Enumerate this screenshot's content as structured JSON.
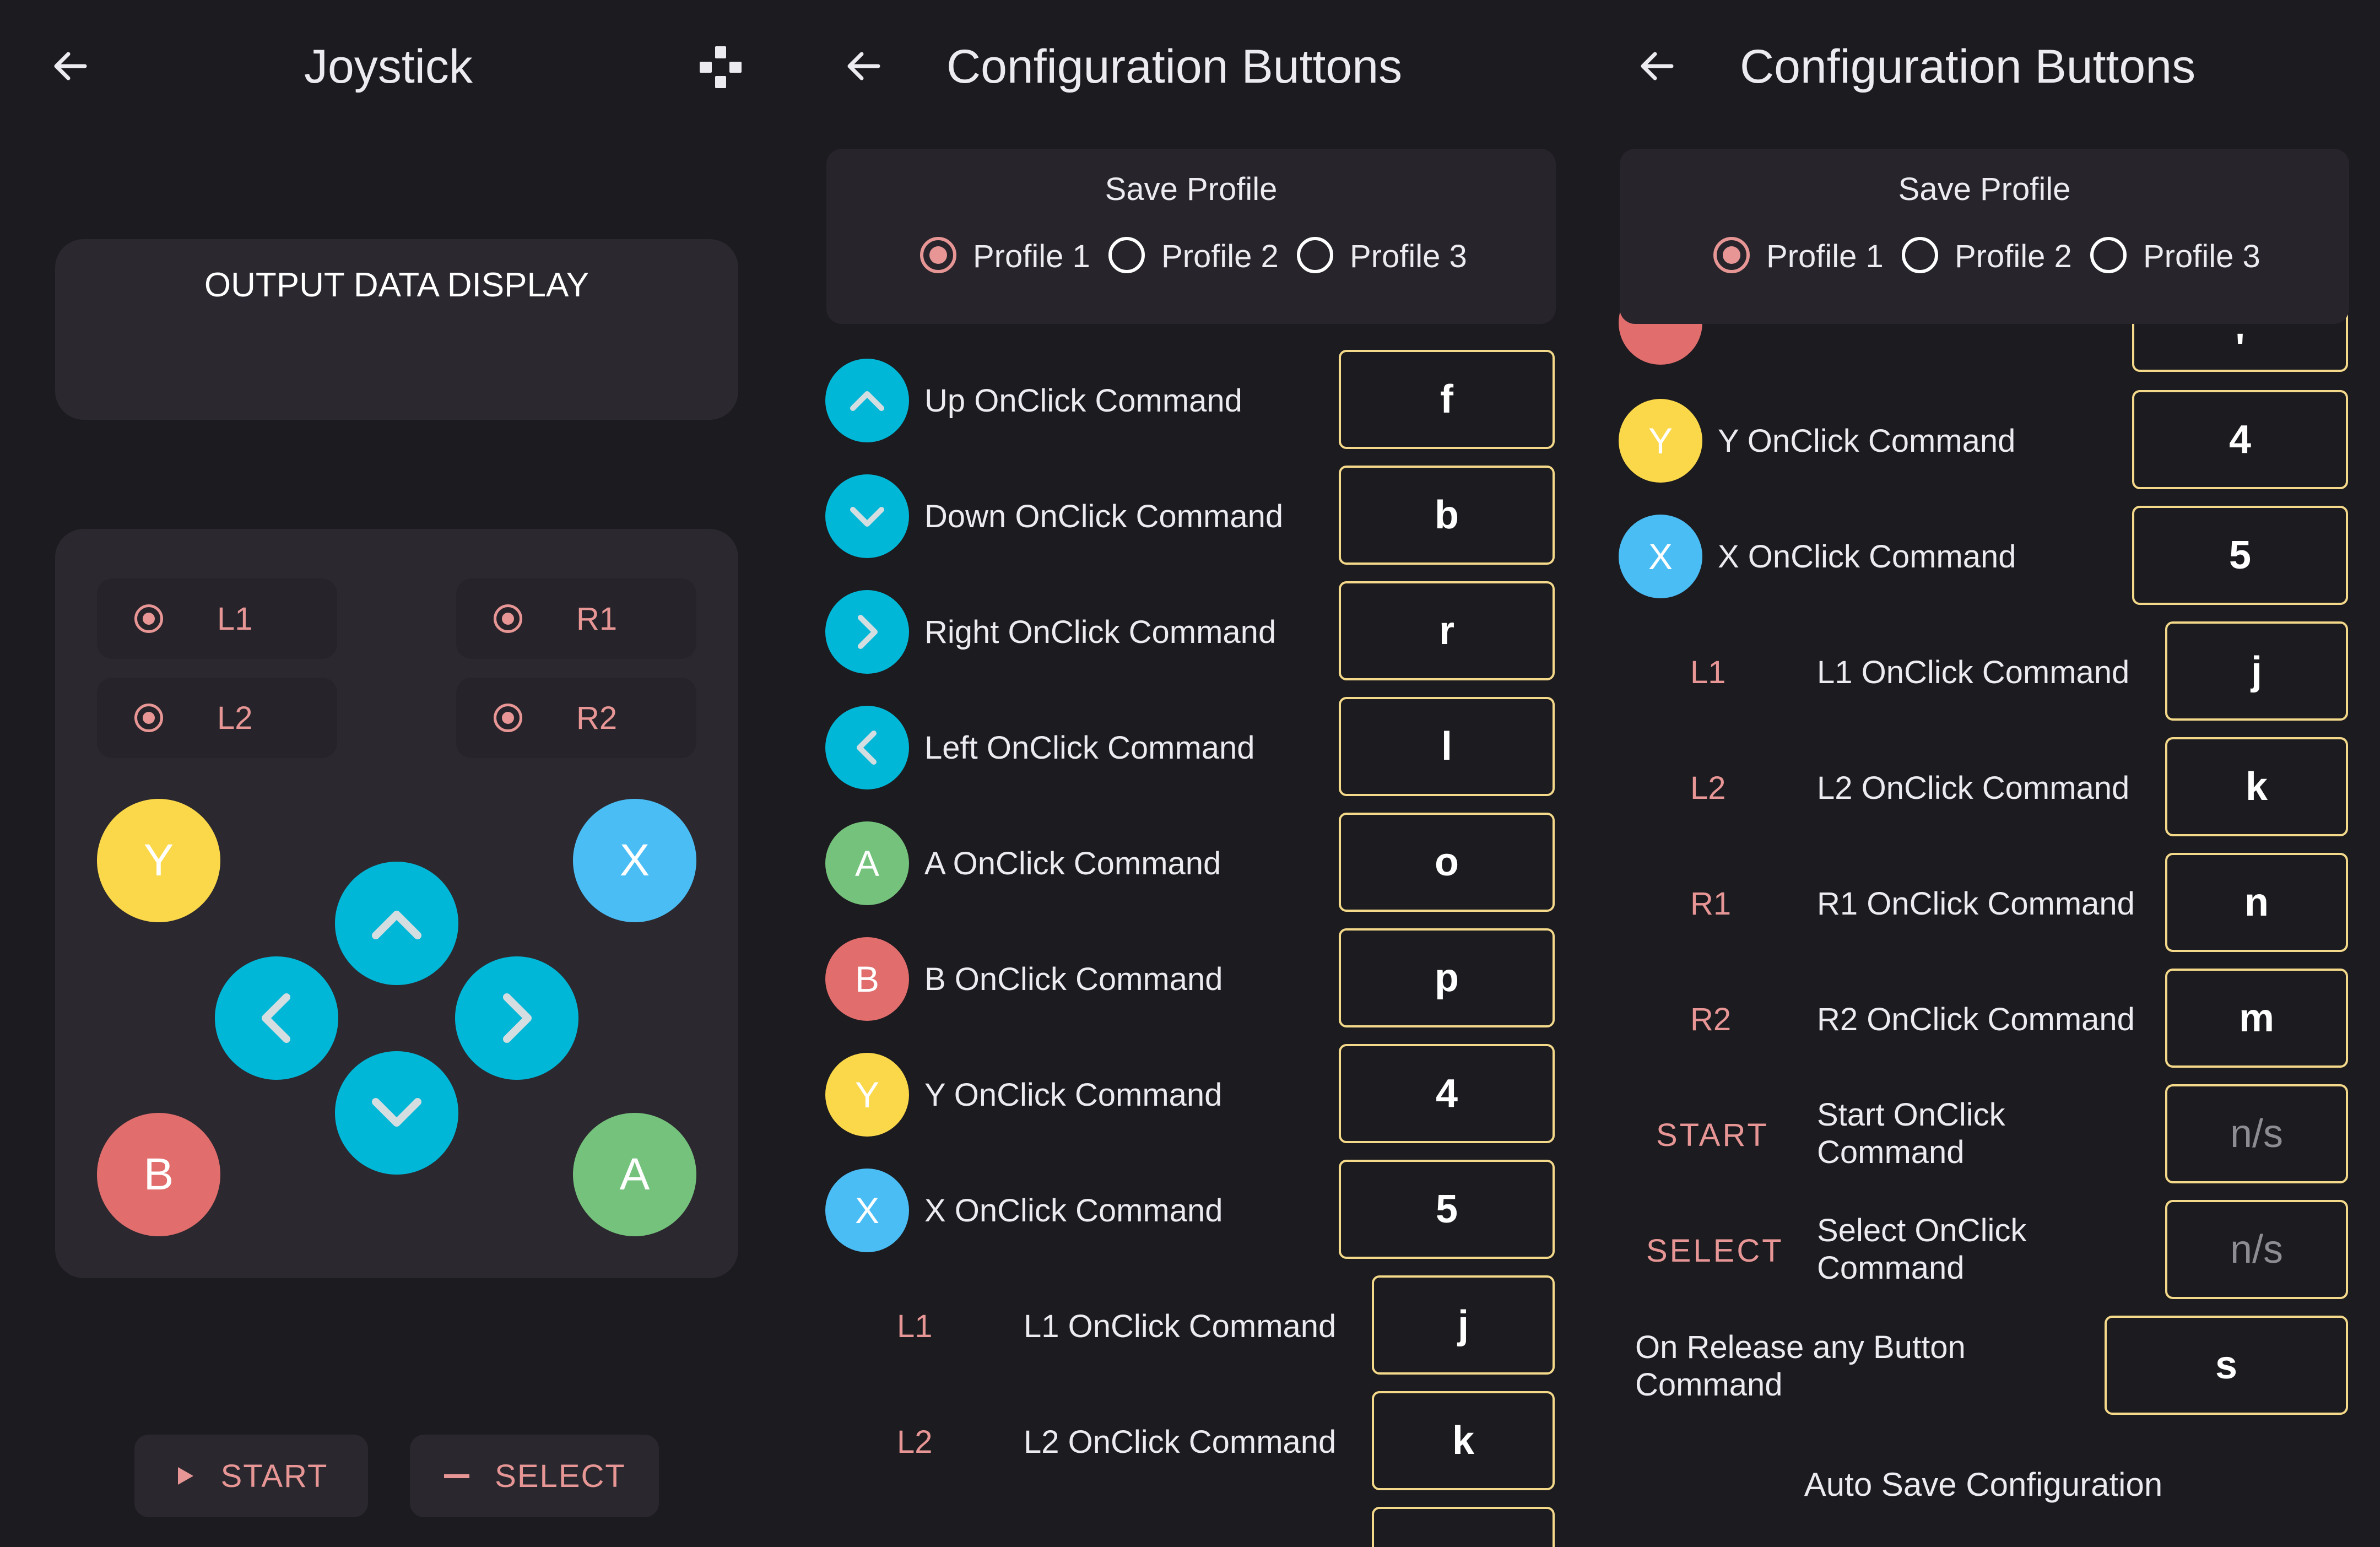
{
  "joystick": {
    "title": "Joystick",
    "output_title": "OUTPUT DATA DISPLAY",
    "shoulder": {
      "l1": "L1",
      "r1": "R1",
      "l2": "L2",
      "r2": "R2"
    },
    "face": {
      "y": "Y",
      "x": "X",
      "b": "B",
      "a": "A"
    },
    "start_label": "START",
    "select_label": "SELECT",
    "icons": [
      "back-arrow-icon",
      "gamepad-icon",
      "chevron-up-icon",
      "chevron-down-icon",
      "chevron-left-icon",
      "chevron-right-icon",
      "play-icon",
      "minus-icon"
    ]
  },
  "config_a": {
    "title": "Configuration Buttons",
    "save_profile": "Save Profile",
    "profiles": [
      "Profile 1",
      "Profile 2",
      "Profile 3"
    ],
    "selected_profile": "Profile 1",
    "rows": [
      {
        "badge": "",
        "icon": "chevron-up-icon",
        "label": "Up OnClick Command",
        "value": "f"
      },
      {
        "badge": "",
        "icon": "chevron-down-icon",
        "label": "Down OnClick Command",
        "value": "b"
      },
      {
        "badge": "",
        "icon": "chevron-right-icon",
        "label": "Right OnClick Command",
        "value": "r"
      },
      {
        "badge": "",
        "icon": "chevron-left-icon",
        "label": "Left OnClick Command",
        "value": "l"
      },
      {
        "badge": "A",
        "label": "A OnClick Command",
        "value": "o"
      },
      {
        "badge": "B",
        "label": "B OnClick Command",
        "value": "p"
      },
      {
        "badge": "Y",
        "label": "Y OnClick Command",
        "value": "4"
      },
      {
        "badge": "X",
        "label": "X OnClick Command",
        "value": "5"
      },
      {
        "badge": "L1",
        "label": "L1 OnClick Command",
        "value": "j"
      },
      {
        "badge": "L2",
        "label": "L2 OnClick Command",
        "value": "k"
      }
    ]
  },
  "config_b": {
    "title": "Configuration Buttons",
    "save_profile": "Save Profile",
    "profiles": [
      "Profile 1",
      "Profile 2",
      "Profile 3"
    ],
    "selected_profile": "Profile 1",
    "partial_top_value": "'",
    "rows": [
      {
        "badge": "Y",
        "label": "Y OnClick Command",
        "value": "4"
      },
      {
        "badge": "X",
        "label": "X OnClick Command",
        "value": "5"
      },
      {
        "badge": "L1",
        "label": "L1 OnClick Command",
        "value": "j"
      },
      {
        "badge": "L2",
        "label": "L2 OnClick Command",
        "value": "k"
      },
      {
        "badge": "R1",
        "label": "R1 OnClick Command",
        "value": "n"
      },
      {
        "badge": "R2",
        "label": "R2 OnClick Command",
        "value": "m"
      },
      {
        "badge": "START",
        "label_line1": "Start OnClick",
        "label_line2": "Command",
        "value": "n/s"
      },
      {
        "badge": "SELECT",
        "label_line1": "Select OnClick",
        "label_line2": "Command",
        "value": "n/s"
      }
    ],
    "release": {
      "label_line1": "On Release any Button",
      "label_line2": "Command",
      "value": "s"
    },
    "auto_save": "Auto Save Configuration"
  },
  "colors": {
    "background": "#1c1b1f",
    "card": "#2b292f",
    "accent_pink": "#e79695",
    "dpad_cyan": "#00b7d7",
    "y_yellow": "#fbd84a",
    "x_blue": "#4bbdf5",
    "b_red": "#e16d6d",
    "a_green": "#75c27c",
    "input_border": "#f4d98a"
  }
}
